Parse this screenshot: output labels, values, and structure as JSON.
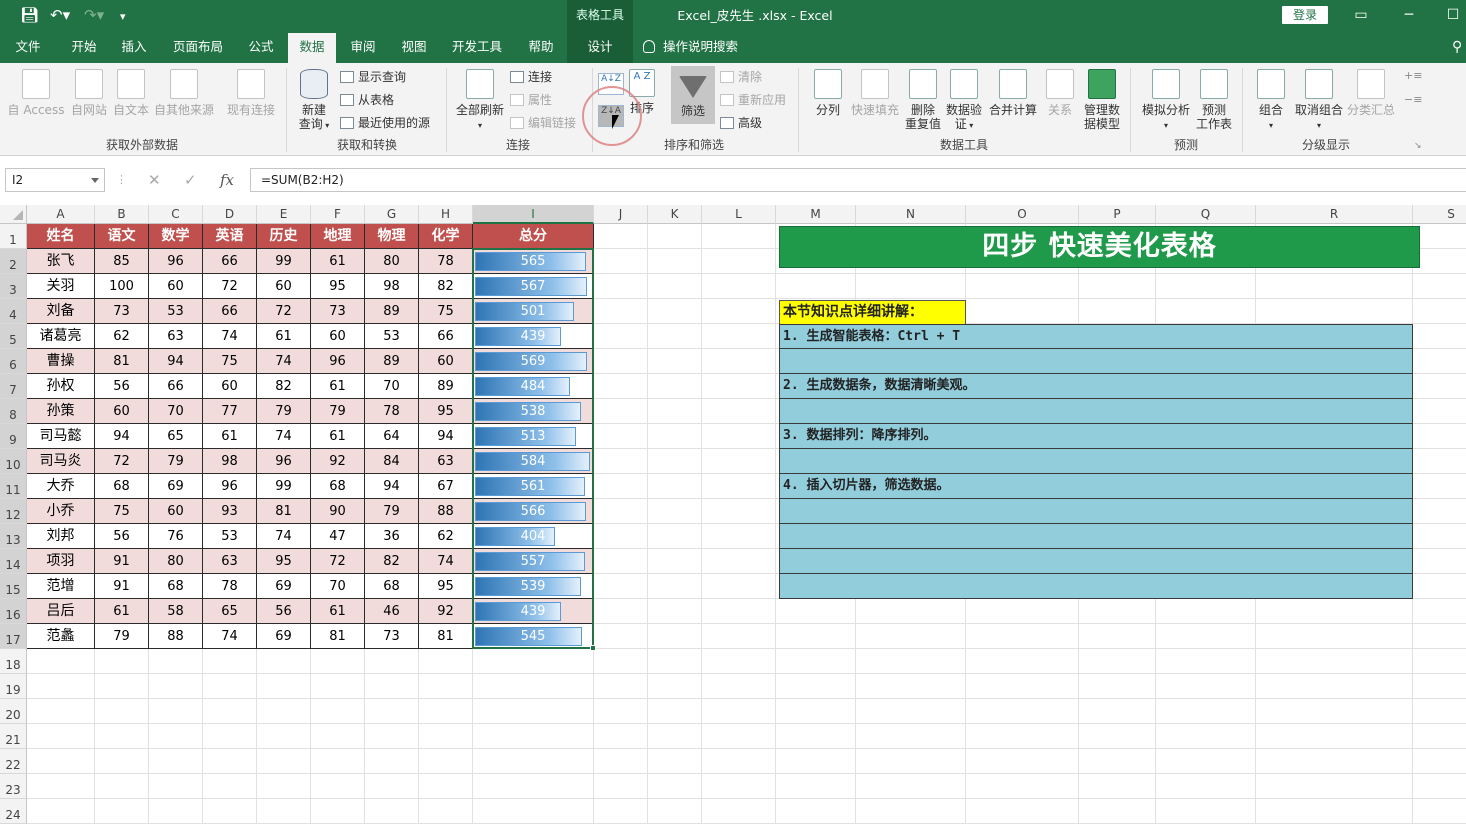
{
  "titlebar": {
    "quick_access": [
      "save-icon",
      "undo-icon",
      "redo-icon",
      "customize-icon"
    ],
    "context_label": "表格工具",
    "title": "Excel_皮先生 .xlsx  -  Excel",
    "login": "登录",
    "ribbon_display": "▭",
    "minimize": "─",
    "maximize": "☐"
  },
  "tabs": [
    "文件",
    "开始",
    "插入",
    "页面布局",
    "公式",
    "数据",
    "审阅",
    "视图",
    "开发工具",
    "帮助",
    "设计"
  ],
  "active_tab": "数据",
  "tell_me": "操作说明搜索",
  "ribbon": {
    "external": {
      "access": "自 Access",
      "web": "自网站",
      "text": "自文本",
      "other": "自其他来源",
      "existing": "现有连接",
      "group": "获取外部数据"
    },
    "transform": {
      "new_query_1": "新建",
      "new_query_2": "查询",
      "show_queries": "显示查询",
      "from_table": "从表格",
      "recent": "最近使用的源",
      "group": "获取和转换"
    },
    "connections": {
      "refresh_all": "全部刷新",
      "connections": "连接",
      "properties": "属性",
      "edit_links": "编辑链接",
      "group": "连接"
    },
    "sort_filter": {
      "sort_asc": "A↓Z",
      "sort_desc": "Z↓A",
      "az": "A Z",
      "sort": "排序",
      "filter": "筛选",
      "clear": "清除",
      "reapply": "重新应用",
      "advanced": "高级",
      "group": "排序和筛选"
    },
    "data_tools": {
      "split": "分列",
      "flash_fill": "快速填充",
      "remove_dup_1": "删除",
      "remove_dup_2": "重复值",
      "validate_1": "数据验",
      "validate_2": "证",
      "consolidate": "合并计算",
      "relations": "关系",
      "model_1": "管理数",
      "model_2": "据模型",
      "group": "数据工具"
    },
    "forecast": {
      "what_if": "模拟分析",
      "sheet_1": "预测",
      "sheet_2": "工作表",
      "group": "预测"
    },
    "outline": {
      "group_btn": "组合",
      "ungroup": "取消组合",
      "subtotal": "分类汇总",
      "group": "分级显示"
    }
  },
  "formula_bar": {
    "name_box": "I2",
    "cancel": "✕",
    "enter": "✓",
    "fx": "fx",
    "formula": "=SUM(B2:H2)"
  },
  "columns": [
    "A",
    "B",
    "C",
    "D",
    "E",
    "F",
    "G",
    "H",
    "I",
    "J",
    "K",
    "L",
    "M",
    "N",
    "O",
    "P",
    "Q",
    "R",
    "S"
  ],
  "rows": [
    "1",
    "2",
    "3",
    "4",
    "5",
    "6",
    "7",
    "8",
    "9",
    "10",
    "11",
    "12",
    "13",
    "14",
    "15",
    "16",
    "17",
    "18",
    "19",
    "20",
    "21",
    "22",
    "23",
    "24"
  ],
  "table": {
    "headers": [
      "姓名",
      "语文",
      "数学",
      "英语",
      "历史",
      "地理",
      "物理",
      "化学",
      "总分"
    ],
    "data_bar_max": 584,
    "data_bar_color": "#2f75b5",
    "header_color": "#c0504d",
    "band_color": "#f2dcdb",
    "rows": [
      [
        "张飞",
        "85",
        "96",
        "66",
        "99",
        "61",
        "80",
        "78",
        "565"
      ],
      [
        "关羽",
        "100",
        "60",
        "72",
        "60",
        "95",
        "98",
        "82",
        "567"
      ],
      [
        "刘备",
        "73",
        "53",
        "66",
        "72",
        "73",
        "89",
        "75",
        "501"
      ],
      [
        "诸葛亮",
        "62",
        "63",
        "74",
        "61",
        "60",
        "53",
        "66",
        "439"
      ],
      [
        "曹操",
        "81",
        "94",
        "75",
        "74",
        "96",
        "89",
        "60",
        "569"
      ],
      [
        "孙权",
        "56",
        "66",
        "60",
        "82",
        "61",
        "70",
        "89",
        "484"
      ],
      [
        "孙策",
        "60",
        "70",
        "77",
        "79",
        "79",
        "78",
        "95",
        "538"
      ],
      [
        "司马懿",
        "94",
        "65",
        "61",
        "74",
        "61",
        "64",
        "94",
        "513"
      ],
      [
        "司马炎",
        "72",
        "79",
        "98",
        "96",
        "92",
        "84",
        "63",
        "584"
      ],
      [
        "大乔",
        "68",
        "69",
        "96",
        "99",
        "68",
        "94",
        "67",
        "561"
      ],
      [
        "小乔",
        "75",
        "60",
        "93",
        "81",
        "90",
        "79",
        "88",
        "566"
      ],
      [
        "刘邦",
        "56",
        "76",
        "53",
        "74",
        "47",
        "36",
        "62",
        "404"
      ],
      [
        "项羽",
        "91",
        "80",
        "63",
        "95",
        "72",
        "82",
        "74",
        "557"
      ],
      [
        "范增",
        "91",
        "68",
        "78",
        "69",
        "70",
        "68",
        "95",
        "539"
      ],
      [
        "吕后",
        "61",
        "58",
        "65",
        "56",
        "61",
        "46",
        "92",
        "439"
      ],
      [
        "范蠡",
        "79",
        "88",
        "74",
        "69",
        "81",
        "73",
        "81",
        "545"
      ]
    ]
  },
  "notes": {
    "banner": "四步  快速美化表格",
    "banner_color": "#1f9a4a",
    "title": "本节知识点详细讲解：",
    "title_color": "#ffff00",
    "row_color": "#92cddc",
    "items": [
      "1. 生成智能表格：Ctrl + T",
      "",
      "2. 生成数据条，数据清晰美观。",
      "",
      "3. 数据排列：降序排列。",
      "",
      "4. 插入切片器，筛选数据。",
      "",
      "",
      "",
      ""
    ]
  }
}
